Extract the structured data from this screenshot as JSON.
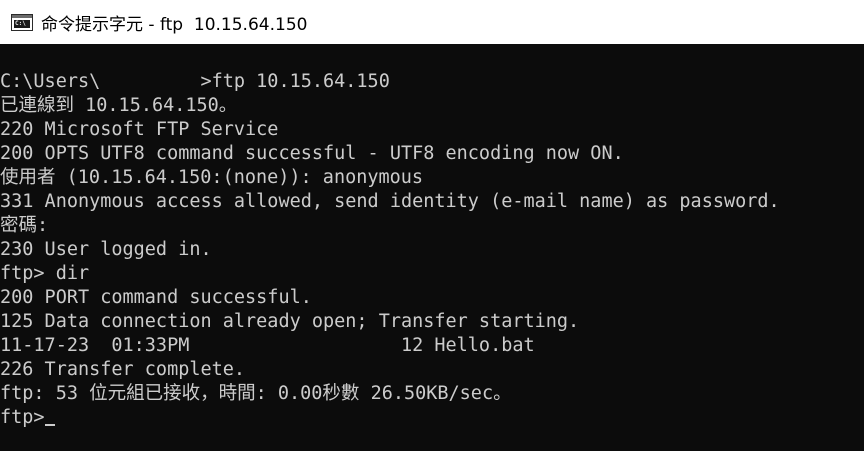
{
  "window": {
    "title": "命令提示字元 - ftp  10.15.64.150",
    "icon": "console-window-icon",
    "icon_glyph": "C:\\",
    "colors": {
      "background": "#0c0c0c",
      "text": "#cccccc",
      "titlebar": "#ffffff"
    }
  },
  "console": {
    "lines": [
      "C:\\Users\\         >ftp 10.15.64.150",
      "已連線到 10.15.64.150。",
      "220 Microsoft FTP Service",
      "200 OPTS UTF8 command successful - UTF8 encoding now ON.",
      "使用者 (10.15.64.150:(none)): anonymous",
      "331 Anonymous access allowed, send identity (e-mail name) as password.",
      "密碼:",
      "230 User logged in.",
      "ftp> dir",
      "200 PORT command successful.",
      "125 Data connection already open; Transfer starting.",
      "11-17-23  01:33PM                   12 Hello.bat",
      "226 Transfer complete.",
      "ftp: 53 位元組已接收，時間: 0.00秒數 26.50KB/sec。"
    ],
    "prompt": "ftp>"
  }
}
